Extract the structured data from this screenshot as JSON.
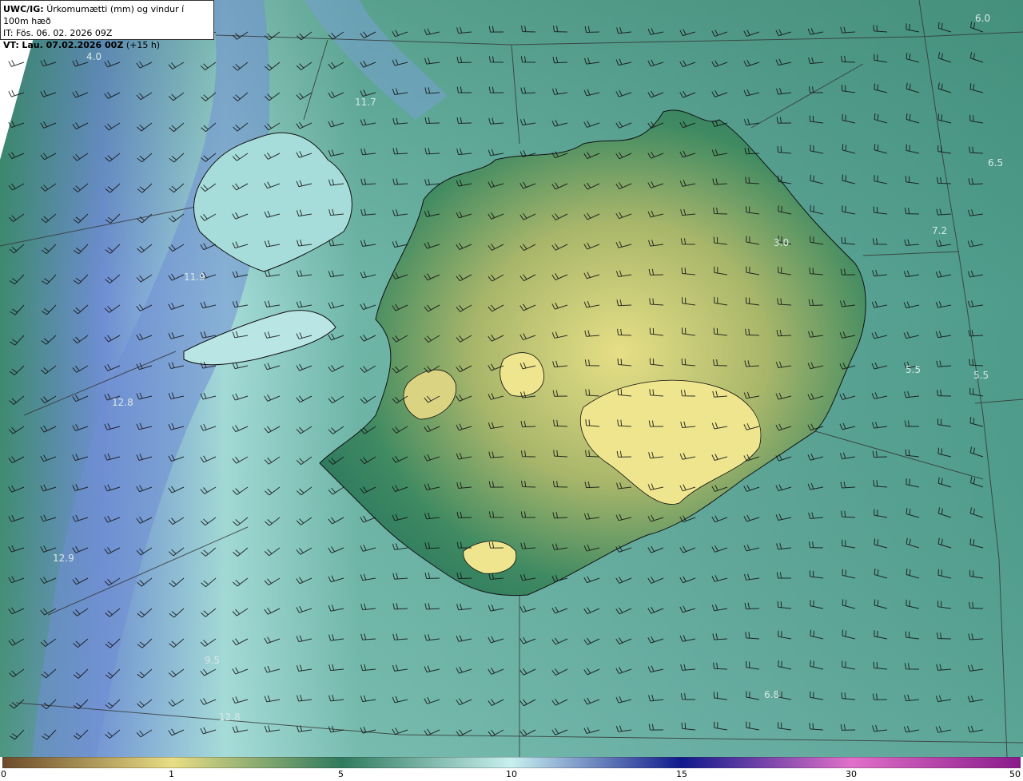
{
  "header": {
    "product": "UWC/IG:",
    "description": "Úrkomumætti (mm) og vindur í 100m hæð",
    "issue_time": "IT: Fös. 06. 02. 2026 09Z",
    "valid_prefix": "VT:",
    "valid_time": "Lau. 07.02.2026 00Z",
    "lead": "(+15 h)"
  },
  "colors": {
    "land_low": "#2f7a5e",
    "land_high": "#e6df86",
    "sea": "#5fa699",
    "sea_light": "#a6dcd9",
    "sea_blue": "#6f8ed4",
    "coast": "#111111",
    "grid": "#333333"
  },
  "legend": {
    "ticks": [
      "0",
      "1",
      "5",
      "10",
      "15",
      "30",
      "50"
    ],
    "stops": [
      {
        "value": 0,
        "color": "#6b4a2a"
      },
      {
        "value": 1,
        "color": "#e8dd84"
      },
      {
        "value": 5,
        "color": "#2f7a5e"
      },
      {
        "value": 10,
        "color": "#c8f0f0"
      },
      {
        "value": 15,
        "color": "#101a8c"
      },
      {
        "value": 30,
        "color": "#e070c8"
      },
      {
        "value": 50,
        "color": "#8a1a8a"
      }
    ]
  },
  "value_labels": [
    {
      "text": "4.0",
      "near": "northwest"
    },
    {
      "text": "11.7",
      "near": "north-northwest"
    },
    {
      "text": "6.0",
      "near": "northeast-corner"
    },
    {
      "text": "6.5",
      "near": "east"
    },
    {
      "text": "7.2",
      "near": "east"
    },
    {
      "text": "3.0",
      "near": "northeast-land"
    },
    {
      "text": "11.9",
      "near": "west"
    },
    {
      "text": "12.8",
      "near": "southwest"
    },
    {
      "text": "5.5",
      "near": "east"
    },
    {
      "text": "5.5",
      "near": "far-east"
    },
    {
      "text": "12.9",
      "near": "southwest"
    },
    {
      "text": "9.5",
      "near": "south-southwest"
    },
    {
      "text": "12.8",
      "near": "south-southwest"
    },
    {
      "text": "6.8",
      "near": "southeast"
    }
  ]
}
